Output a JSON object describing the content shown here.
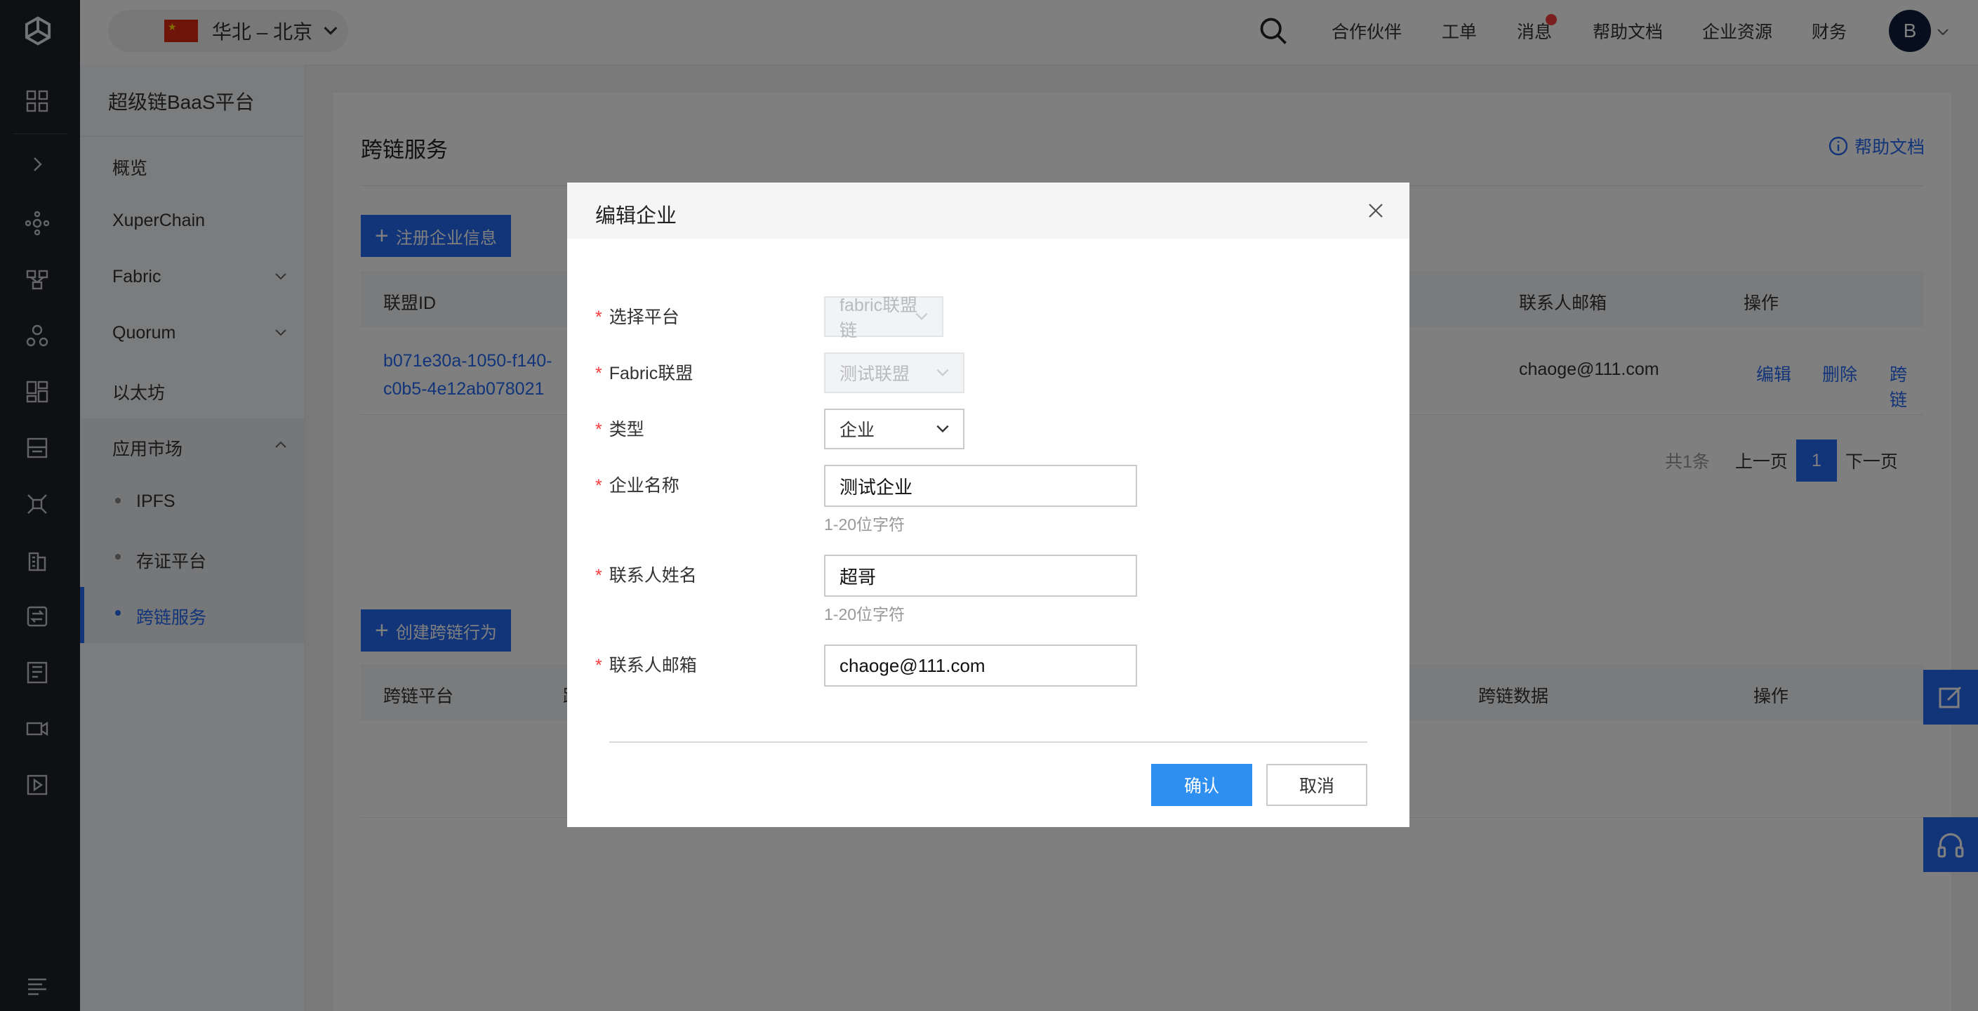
{
  "colors": {
    "accent": "#2468f2",
    "rail_bg": "#1e2129",
    "required": "#f33e3e",
    "badge": "#f33e3e"
  },
  "topbar": {
    "region_label": "华北 – 北京",
    "links": [
      "合作伙伴",
      "工单",
      "消息",
      "帮助文档",
      "企业资源",
      "财务"
    ],
    "avatar_letter": "B"
  },
  "sidebar": {
    "title": "超级链BaaS平台",
    "items": [
      {
        "label": "概览"
      },
      {
        "label": "XuperChain"
      },
      {
        "label": "Fabric"
      },
      {
        "label": "Quorum"
      },
      {
        "label": "以太坊"
      },
      {
        "label": "应用市场"
      }
    ],
    "subitems": [
      {
        "label": "IPFS"
      },
      {
        "label": "存证平台"
      },
      {
        "label": "跨链服务"
      }
    ]
  },
  "page": {
    "title": "跨链服务",
    "help_link": "帮助文档",
    "register_button": "注册企业信息",
    "table1": {
      "headers": [
        "联盟ID",
        "联系人邮箱",
        "操作"
      ],
      "row": {
        "id_line1": "b071e30a-1050-f140-",
        "id_line2": "c0b5-4e12ab078021",
        "email": "chaoge@111.com",
        "actions": [
          "编辑",
          "删除",
          "跨链"
        ]
      }
    },
    "pagination": {
      "total": "共1条",
      "prev": "上一页",
      "current": "1",
      "next": "下一页"
    },
    "create_button": "创建跨链行为",
    "table2": {
      "headers": [
        "跨链平台",
        "跨链数据",
        "操作"
      ],
      "partial_header": "跨"
    }
  },
  "modal": {
    "title": "编辑企业",
    "fields": {
      "platform": {
        "label": "选择平台",
        "value": "fabric联盟链"
      },
      "alliance": {
        "label": "Fabric联盟",
        "value": "测试联盟"
      },
      "type": {
        "label": "类型",
        "value": "企业"
      },
      "company": {
        "label": "企业名称",
        "value": "测试企业",
        "hint": "1-20位字符"
      },
      "contact": {
        "label": "联系人姓名",
        "value": "超哥",
        "hint": "1-20位字符"
      },
      "email": {
        "label": "联系人邮箱",
        "value": "chaoge@111.com"
      }
    },
    "confirm_label": "确认",
    "cancel_label": "取消"
  }
}
